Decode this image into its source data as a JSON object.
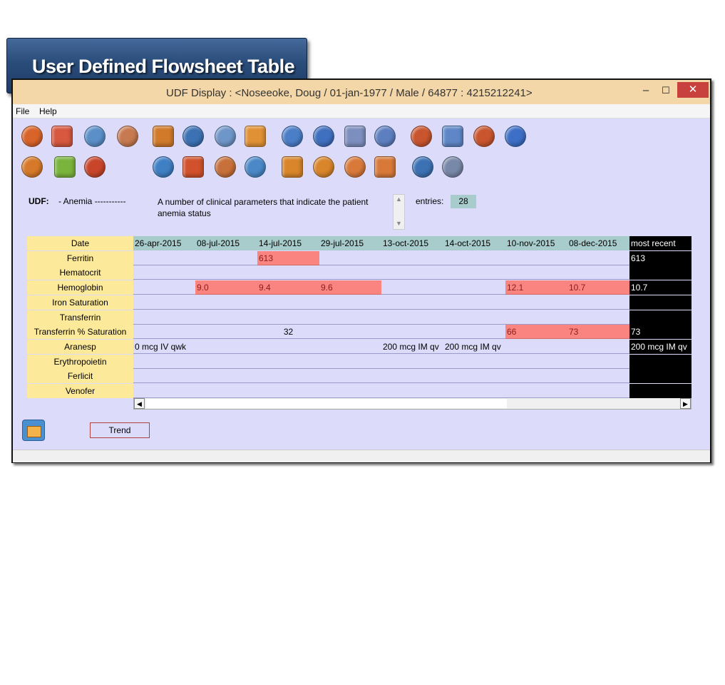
{
  "banner": {
    "title": "User Defined Flowsheet Table"
  },
  "window": {
    "title": "UDF Display : <Noseeoke, Doug  / 01-jan-1977 / Male / 64877 : 4215212241>",
    "controls": {
      "minimize": "–",
      "maximize": "☐",
      "close": "✕"
    }
  },
  "menu": {
    "file": "File",
    "help": "Help"
  },
  "toolbar": {
    "row1": [
      {
        "name": "doctor-icon",
        "color": "#d9642a"
      },
      {
        "name": "pills-icon",
        "color": "#d7583f"
      },
      {
        "name": "stethoscope-icon",
        "color": "#5a8fc8"
      },
      {
        "name": "handshake-icon",
        "color": "#c77a50"
      },
      {
        "name": "notes-icon",
        "color": "#d07a2a"
      },
      {
        "name": "chart-icon",
        "color": "#3c72b4"
      },
      {
        "name": "print-icon",
        "color": "#6f96c8"
      },
      {
        "name": "medkit-icon",
        "color": "#e09135"
      },
      {
        "name": "hd-schedule-icon",
        "color": "#4a7ec7"
      },
      {
        "name": "hd-icon",
        "color": "#3f6fbf"
      },
      {
        "name": "hand-icon",
        "color": "#7d8fbe"
      },
      {
        "name": "clock-icon",
        "color": "#5d7fc0"
      },
      {
        "name": "labs-icon",
        "color": "#c9552e"
      },
      {
        "name": "lab-search-icon",
        "color": "#5f87c7"
      },
      {
        "name": "lab-results-icon",
        "color": "#c9552e"
      },
      {
        "name": "help-icon",
        "color": "#3d6fc6"
      }
    ],
    "row2": [
      {
        "name": "calendar-icon",
        "color": "#d7792a"
      },
      {
        "name": "dollar-icon",
        "color": "#7ab43c"
      },
      {
        "name": "contact-book-icon",
        "color": "#c8452a"
      },
      {
        "name": "puzzle-icon",
        "color": "#3f7fc4"
      },
      {
        "name": "apple-icon",
        "color": "#d1512c"
      },
      {
        "name": "document-flag-icon",
        "color": "#c7703a"
      },
      {
        "name": "home-icon",
        "color": "#4a88c8"
      },
      {
        "name": "pd-schedule-icon",
        "color": "#d9852a"
      },
      {
        "name": "pd-icon",
        "color": "#d9852a"
      },
      {
        "name": "body-front-icon",
        "color": "#d8793a"
      },
      {
        "name": "body-back-icon",
        "color": "#d8793a"
      },
      {
        "name": "bar-graph-icon",
        "color": "#3c72b4"
      },
      {
        "name": "magnifier-icon",
        "color": "#7888a8"
      }
    ]
  },
  "udf": {
    "label": "UDF:",
    "name": "- Anemia -----------",
    "description": "A number of clinical parameters that  indicate the patient anemia status",
    "entries_label": "entries:",
    "entries_value": "28"
  },
  "table": {
    "header_label": "Date",
    "columns": [
      "26-apr-2015",
      "08-jul-2015",
      "14-jul-2015",
      "29-jul-2015",
      "13-oct-2015",
      "14-oct-2015",
      "10-nov-2015",
      "08-dec-2015"
    ],
    "recent_label": "most recent",
    "rows": [
      {
        "label": "Ferritin",
        "cells": [
          {
            "col": 2,
            "text": "613",
            "red": true
          }
        ],
        "recent": "613"
      },
      {
        "label": "Hematocrit",
        "cells": [],
        "recent": ""
      },
      {
        "label": "Hemoglobin",
        "cells": [
          {
            "col": 1,
            "text": "9.0",
            "red": true
          },
          {
            "col": 2,
            "text": "9.4",
            "red": true
          },
          {
            "col": 3,
            "text": "9.6",
            "red": true
          },
          {
            "col": 6,
            "text": "12.1",
            "red": true
          },
          {
            "col": 7,
            "text": "10.7",
            "red": true
          }
        ],
        "recent": "10.7"
      },
      {
        "label": "Iron Saturation",
        "cells": [],
        "recent": ""
      },
      {
        "label": "Transferrin",
        "cells": [],
        "recent": ""
      },
      {
        "label": "Transferrin % Saturation",
        "cells": [
          {
            "col": 2,
            "text": "32",
            "red": false,
            "center": true
          },
          {
            "col": 6,
            "text": "66",
            "red": true
          },
          {
            "col": 7,
            "text": "73",
            "red": true
          }
        ],
        "recent": "73"
      },
      {
        "label": "Aranesp",
        "cells": [
          {
            "col": 0,
            "text": "0 mcg IV qwk",
            "red": false
          },
          {
            "col": 4,
            "text": "200 mcg IM qv",
            "red": false
          },
          {
            "col": 5,
            "text": "200 mcg IM qv",
            "red": false
          }
        ],
        "recent": "200 mcg IM qv"
      },
      {
        "label": "Erythropoietin",
        "cells": [],
        "recent": ""
      },
      {
        "label": "Ferlicit",
        "cells": [],
        "recent": ""
      },
      {
        "label": "Venofer",
        "cells": [],
        "recent": ""
      }
    ]
  },
  "scroll": {
    "left": "◀",
    "right": "▶"
  },
  "footer": {
    "trend_label": "Trend"
  }
}
